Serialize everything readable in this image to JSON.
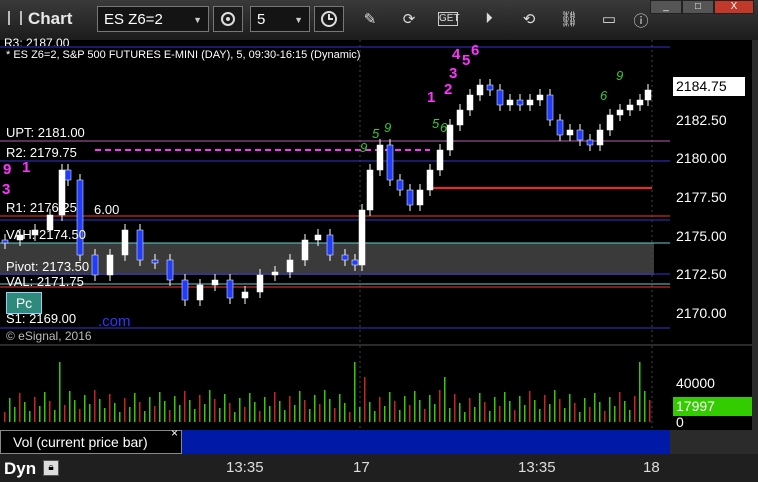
{
  "window": {
    "title": "Chart",
    "min_label": "_",
    "max_label": "□",
    "close_label": "X"
  },
  "toolbar": {
    "symbol": "ES Z6=2",
    "interval": "5"
  },
  "chart": {
    "header_line": "* ES Z6=2, S&P 500 FUTURES E-MINI (DAY), 5, 09:30-16:15 (Dynamic)",
    "top_cut_label": "R3: 2187.00",
    "copyright": "© eSignal, 2016",
    "levels": {
      "upt": "UPT: 2181.00",
      "r2": "R2: 2179.75",
      "r1": "R1: 2176.25",
      "r1_extra": "6.00",
      "vah": "VAH: 2174.50",
      "pivot": "Pivot: 2173.50",
      "val": "VAL: 2171.75",
      "s1": "S1: 2169.00"
    },
    "watermark_dotcom": ".com",
    "pc_label": "Pc",
    "y_axis": [
      "2182.50",
      "2180.00",
      "2177.50",
      "2175.00",
      "2172.50",
      "2170.00"
    ],
    "current_price": "2184.75",
    "accent_price": "#ffffff",
    "markers": {
      "m1": "1",
      "m2": "2",
      "m3": "3",
      "m4": "4",
      "m5": "5",
      "m6": "6",
      "left9": "9",
      "left1": "1",
      "leftmark": "3",
      "g1": "9",
      "g2": "5",
      "g3": "6",
      "g4": "9",
      "g5": "5",
      "g6": "9",
      "g7": "6"
    }
  },
  "volume": {
    "label": "Vol (current price bar)",
    "close": "×",
    "axis": [
      "40000",
      "0"
    ],
    "current": "17997",
    "current_color": "#33cc00"
  },
  "x_axis": [
    "13:35",
    "17",
    "13:35",
    "18"
  ],
  "status": {
    "label": "Dyn"
  }
}
